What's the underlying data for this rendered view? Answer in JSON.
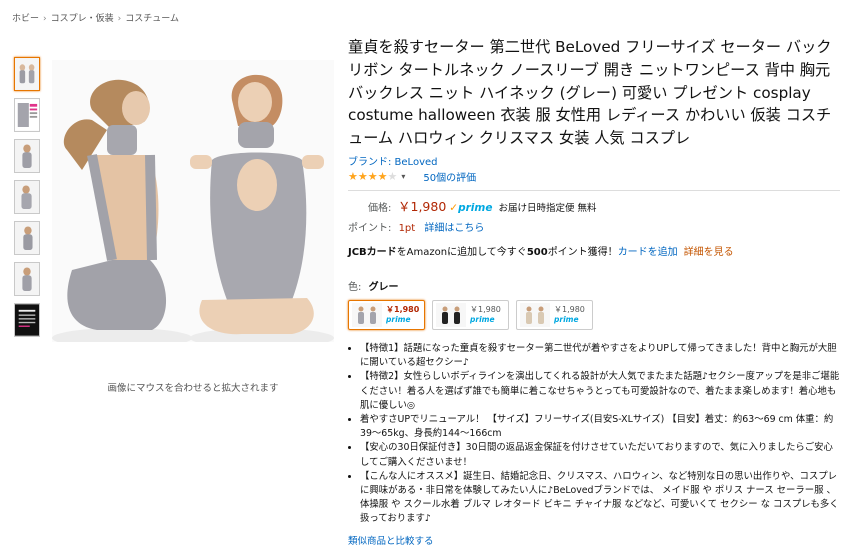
{
  "breadcrumb": [
    "ホビー",
    "コスプレ・仮装",
    "コスチューム"
  ],
  "breadcrumb_separator": "›",
  "zoom_hint": "画像にマウスを合わせると拡大されます",
  "product": {
    "title": "童貞を殺すセーター 第二世代 BeLoved フリーサイズ セーター バックリボン タートルネック ノースリーブ 開き ニットワンピース 背中 胸元 バックレス ニット ハイネック (グレー) 可愛い プレゼント cosplay costume halloween 衣装 服 女性用 レディース かわいい 仮装 コスチューム ハロウィン クリスマス 女装 人気 コスプレ",
    "brand": "ブランド: BeLoved",
    "rating_value": 4.0,
    "rating_stars_full": "★★★★",
    "rating_stars_empty": "★",
    "rating_chevron": "▾",
    "reviews": "50個の評価",
    "price_label": "価格:",
    "price": "￥1,980",
    "prime_label": "prime",
    "delivery": "お届け日時指定便 無料",
    "points_label": "ポイント:",
    "points_value": "1pt",
    "points_link": "詳細はこちら",
    "jcb_pre": "JCBカード",
    "jcb_mid1": "をAmazonに追加して今すぐ",
    "jcb_bold": "500",
    "jcb_mid2": "ポイント獲得！",
    "jcb_link1": "カードを追加",
    "jcb_link2": "詳細を見る",
    "color_label": "色:",
    "color_value": "グレー",
    "variants": [
      {
        "price": "￥1,980",
        "prime": "prime"
      },
      {
        "price": "￥1,980",
        "prime": "prime"
      },
      {
        "price": "￥1,980",
        "prime": "prime"
      }
    ],
    "bullets": [
      "【特徴1】話題になった童貞を殺すセーター第二世代が着やすさをよりUPして帰ってきました！背中と胸元が大胆に開いている超セクシー♪",
      "【特徴2】女性らしいボディラインを演出してくれる設計が大人気でまたまた話題♪セクシー度アップを是非ご堪能ください！着る人を選ばず誰でも簡単に着こなせちゃうとっても可愛設計なので、着たまま楽しめます！着心地も肌に優しい◎",
      "着やすさUPでリニューアル！ 【サイズ】フリーサイズ(目安S-XLサイズ) 【目安】着丈：約63〜69 cm 体重：約39〜65kg、身長約144〜166cm",
      "【安心の30日保証付き】30日間の返品返金保証を付けさせていただいておりますので、気に入りましたらご安心してご購入くださいませ！",
      "【こんな人にオススメ】誕生日、結婚記念日、クリスマス、ハロウィン、など特別な日の思い出作りや、コスプレに興味がある・非日常を体験してみたい人に♪BeLovedブランドでは、 メイド服 や ポリス ナース セーラー服 、体操服 や スクール水着 ブルマ レオタード ビキニ チャイナ服 などなど、可愛いくて セクシー な コスプレも多く扱っております♪"
    ],
    "compare_link": "類似商品と比較する"
  },
  "colors": {
    "link": "#0066c0",
    "price": "#b12704",
    "prime": "#00a8e1",
    "star": "#ffa41c",
    "selected_border": "#e77600"
  }
}
